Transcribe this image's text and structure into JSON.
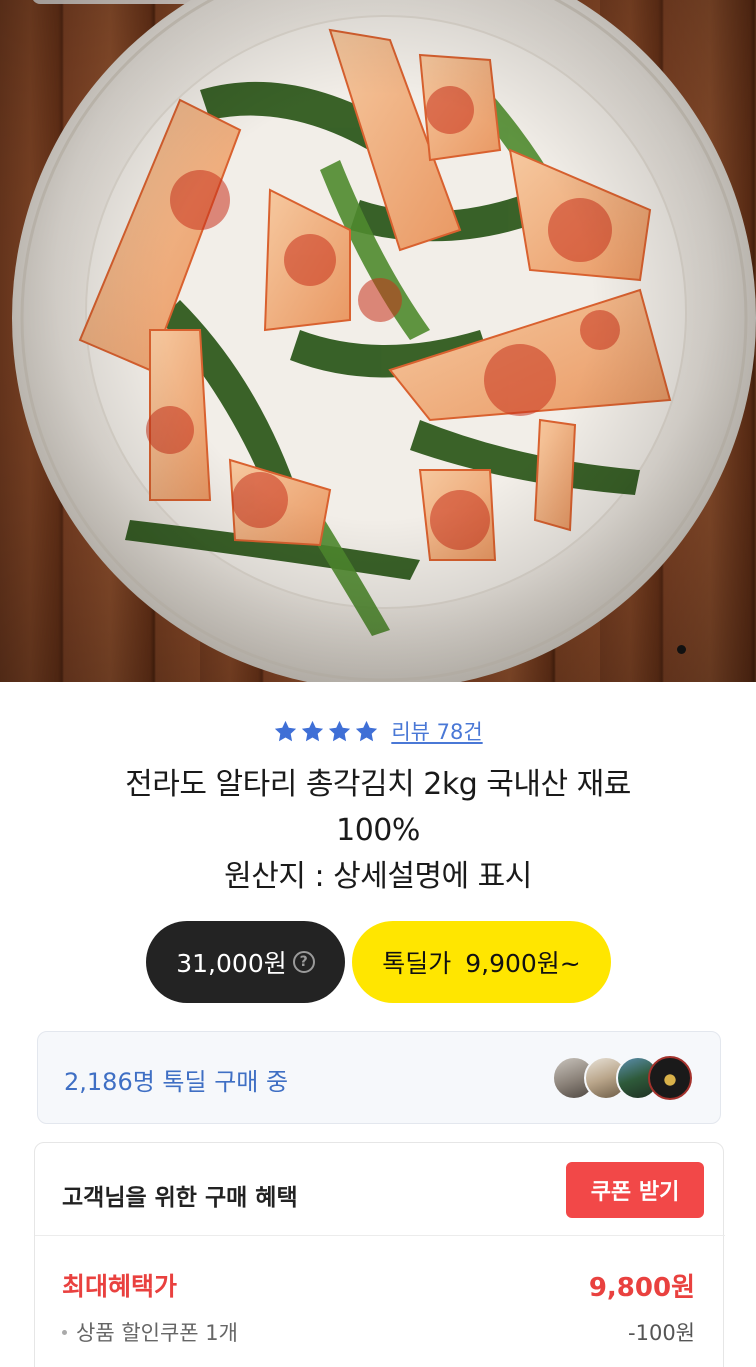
{
  "hero": {
    "image_alt": "총각김치 사진",
    "page_indicator_icon": "dot-indicator"
  },
  "rating": {
    "stars": 4,
    "star_color": "#3f6fd6",
    "review_link": "리뷰 78건"
  },
  "product": {
    "title_line1": "전라도 알타리 총각김치 2kg 국내산 재료",
    "title_line2": "100%",
    "title_line3": "원산지 : 상세설명에 표시"
  },
  "price": {
    "original": "31,000원",
    "help_icon": "question-circle-icon",
    "deal_label": "톡딜가",
    "deal_price": "9,900원~"
  },
  "buyers": {
    "text": "2,186명 톡딜 구매 중"
  },
  "benefits": {
    "title": "고객님을 위한 구매 혜택",
    "coupon_button": "쿠폰 받기",
    "max_label": "최대혜택가",
    "max_value": "9,800원",
    "rows": [
      {
        "label": "상품 할인쿠폰 1개",
        "value": "-100원"
      }
    ]
  },
  "colors": {
    "accent_red": "#f24848",
    "deal_yellow": "#ffe600",
    "link_blue": "#4a78d6"
  }
}
